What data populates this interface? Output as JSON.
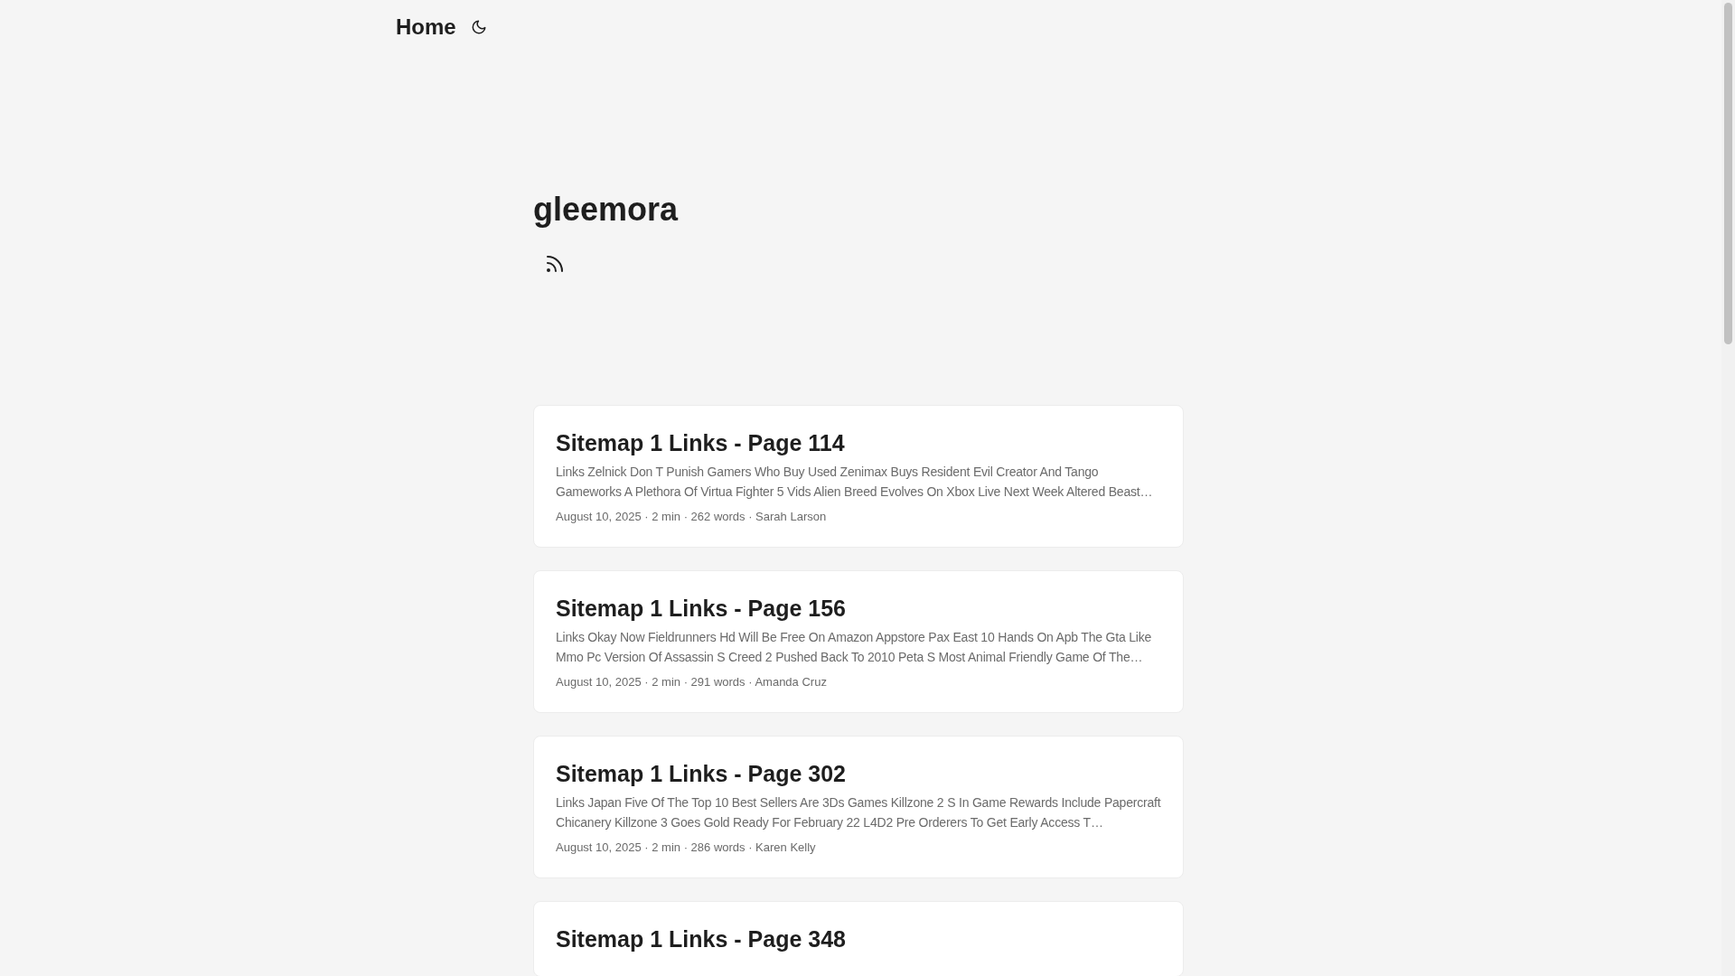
{
  "header": {
    "home": "Home"
  },
  "profile": {
    "title": "gleemora"
  },
  "posts": [
    {
      "title": "Sitemap 1 Links - Page 114",
      "summary": "Links Zelnick Don T Punish Gamers Who Buy Used Zenimax Buys Resident Evil Creator And Tango Gameworks A Plethora Of Virtua Fighter 5 Vids Alien Breed Evolves On Xbox Live Next Week Altered Beast…",
      "meta": "August 10, 2025 · 2 min · 262 words · Sarah Larson"
    },
    {
      "title": "Sitemap 1 Links - Page 156",
      "summary": "Links Okay Now Fieldrunners Hd Will Be Free On Amazon Appstore Pax East 10 Hands On Apb The Gta Like Mmo Pc Version Of Assassin S Creed 2 Pushed Back To 2010 Peta S Most Animal Friendly Game Of The…",
      "meta": "August 10, 2025 · 2 min · 291 words · Amanda Cruz"
    },
    {
      "title": "Sitemap 1 Links - Page 302",
      "summary": "Links Japan Five Of The Top 10 Best Sellers Are 3Ds Games Killzone 2 S In Game Rewards Include Papercraft Chicanery Killzone 3 Goes Gold Ready For February 22 L4D2 Pre Orderers To Get Early Access T…",
      "meta": "August 10, 2025 · 2 min · 286 words · Karen Kelly"
    },
    {
      "title": "Sitemap 1 Links - Page 348"
    }
  ]
}
